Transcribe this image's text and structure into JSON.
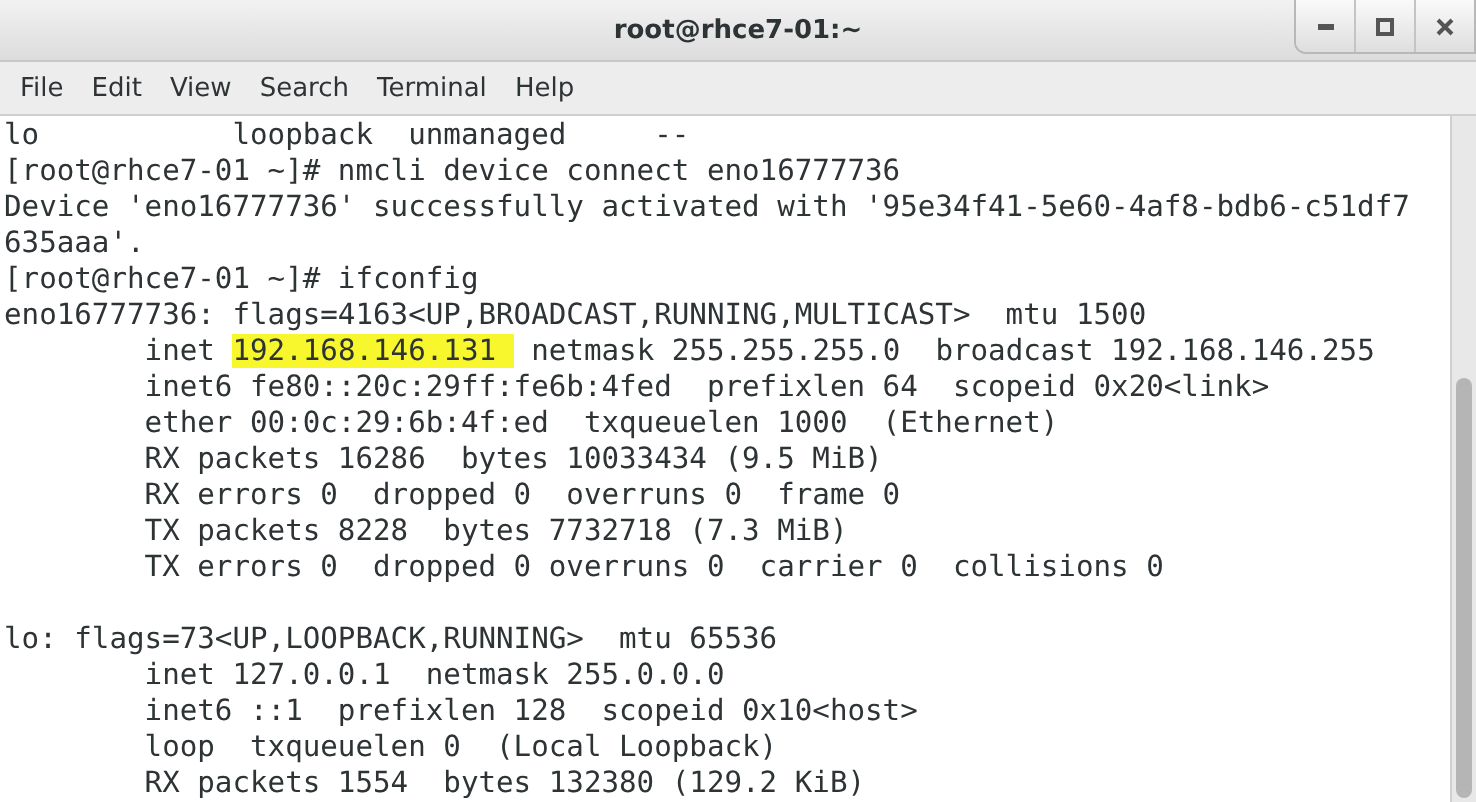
{
  "window": {
    "title": "root@rhce7-01:~"
  },
  "menu": [
    "File",
    "Edit",
    "View",
    "Search",
    "Terminal",
    "Help"
  ],
  "terminal": {
    "lines": [
      [
        {
          "text": "lo           loopback  unmanaged     --",
          "highlighted": false
        }
      ],
      [
        {
          "text": "[root@rhce7-01 ~]# nmcli device connect eno16777736",
          "highlighted": false
        }
      ],
      [
        {
          "text": "Device 'eno16777736' successfully activated with '95e34f41-5e60-4af8-bdb6-c51df7",
          "highlighted": false
        }
      ],
      [
        {
          "text": "635aaa'.",
          "highlighted": false
        }
      ],
      [
        {
          "text": "[root@rhce7-01 ~]# ifconfig",
          "highlighted": false
        }
      ],
      [
        {
          "text": "eno16777736: flags=4163<UP,BROADCAST,RUNNING,MULTICAST>  mtu 1500",
          "highlighted": false
        }
      ],
      [
        {
          "text": "        inet ",
          "highlighted": false
        },
        {
          "text": "192.168.146.131 ",
          "highlighted": true
        },
        {
          "text": " netmask 255.255.255.0  broadcast 192.168.146.255",
          "highlighted": false
        }
      ],
      [
        {
          "text": "        inet6 fe80::20c:29ff:fe6b:4fed  prefixlen 64  scopeid 0x20<link>",
          "highlighted": false
        }
      ],
      [
        {
          "text": "        ether 00:0c:29:6b:4f:ed  txqueuelen 1000  (Ethernet)",
          "highlighted": false
        }
      ],
      [
        {
          "text": "        RX packets 16286  bytes 10033434 (9.5 MiB)",
          "highlighted": false
        }
      ],
      [
        {
          "text": "        RX errors 0  dropped 0  overruns 0  frame 0",
          "highlighted": false
        }
      ],
      [
        {
          "text": "        TX packets 8228  bytes 7732718 (7.3 MiB)",
          "highlighted": false
        }
      ],
      [
        {
          "text": "        TX errors 0  dropped 0 overruns 0  carrier 0  collisions 0",
          "highlighted": false
        }
      ],
      {
        "kind": "blank"
      },
      [
        {
          "text": "lo: flags=73<UP,LOOPBACK,RUNNING>  mtu 65536",
          "highlighted": false
        }
      ],
      [
        {
          "text": "        inet 127.0.0.1  netmask 255.0.0.0",
          "highlighted": false
        }
      ],
      [
        {
          "text": "        inet6 ::1  prefixlen 128  scopeid 0x10<host>",
          "highlighted": false
        }
      ],
      [
        {
          "text": "        loop  txqueuelen 0  (Local Loopback)",
          "highlighted": false
        }
      ],
      [
        {
          "text": "        RX packets 1554  bytes 132380 (129.2 KiB)",
          "highlighted": false
        }
      ]
    ]
  }
}
